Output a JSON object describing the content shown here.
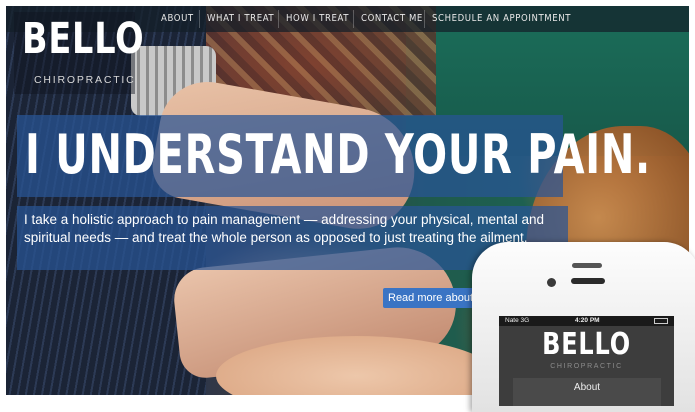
{
  "nav": {
    "items": [
      {
        "label": "ABOUT"
      },
      {
        "label": "WHAT I TREAT"
      },
      {
        "label": "HOW I TREAT"
      },
      {
        "label": "CONTACT ME"
      },
      {
        "label": "SCHEDULE AN APPOINTMENT"
      }
    ]
  },
  "logo": {
    "title": "BELLO",
    "subtitle": "CHIROPRACTIC"
  },
  "hero": {
    "headline": "I UNDERSTAND YOUR PAIN.",
    "paragraph": "I take a holistic approach to pain management — addressing your physical, mental and spiritual needs — and treat the whole person as opposed to just treating the ailment.",
    "read_more": "Read more about how I treat"
  },
  "phone": {
    "carrier": "Nate 3G",
    "time": "4:20 PM",
    "logo_title": "BELLO",
    "logo_subtitle": "CHIROPRACTIC",
    "menu_item": "About"
  },
  "colors": {
    "accent": "#3a74c4",
    "overlay": "#2855a0"
  }
}
